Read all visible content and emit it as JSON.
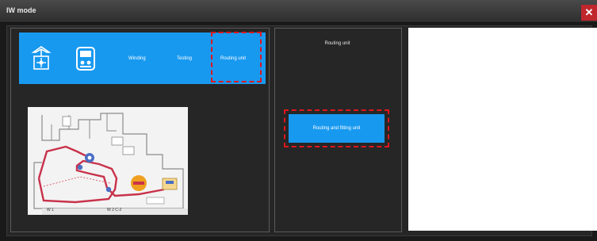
{
  "window": {
    "title": "IW mode",
    "close_symbol": "✕"
  },
  "toolbar": {
    "items": [
      {
        "label": "",
        "icon": "robot-arm-icon"
      },
      {
        "label": "",
        "icon": "controller-icon"
      },
      {
        "label": "Winding",
        "icon": ""
      },
      {
        "label": "Testing",
        "icon": ""
      },
      {
        "label": "Routing unit",
        "icon": "",
        "highlighted": true
      }
    ]
  },
  "middle": {
    "title": "Routing unit",
    "action_button": "Routing and fitting unit"
  },
  "map": {
    "labels": [
      "W 1",
      "W 2  C-2"
    ]
  },
  "colors": {
    "accent": "#1899f0",
    "highlight": "#e0161c",
    "panel_bg": "#262626",
    "route": "#c8324a",
    "node_orange": "#f0a020"
  }
}
